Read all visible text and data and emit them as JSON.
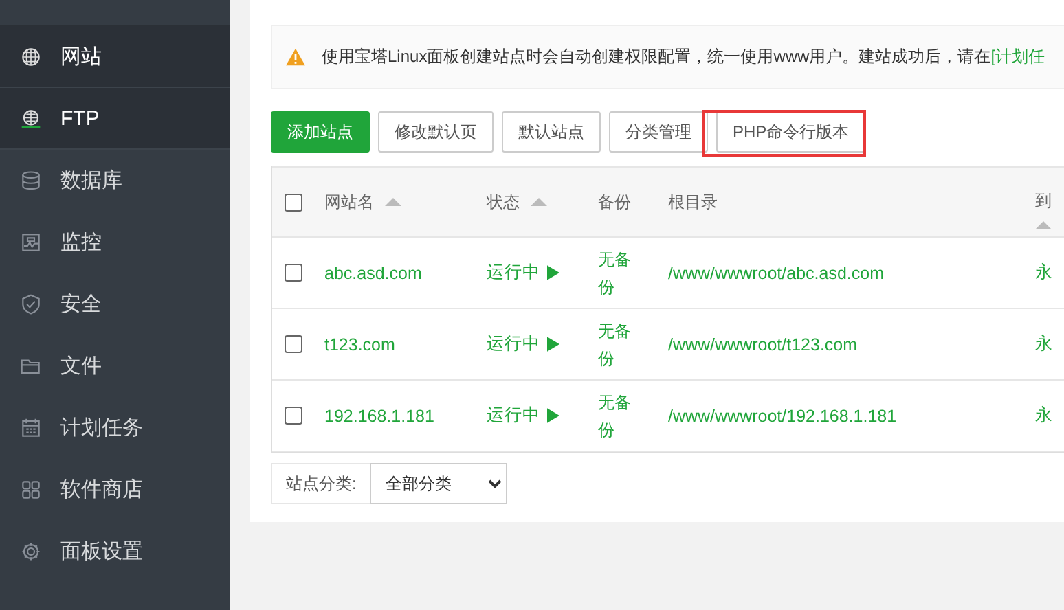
{
  "sidebar": {
    "items": [
      {
        "label": "网站",
        "selected": true
      },
      {
        "label": "FTP",
        "selected": true
      },
      {
        "label": "数据库",
        "selected": false
      },
      {
        "label": "监控",
        "selected": false
      },
      {
        "label": "安全",
        "selected": false
      },
      {
        "label": "文件",
        "selected": false
      },
      {
        "label": "计划任务",
        "selected": false
      },
      {
        "label": "软件商店",
        "selected": false
      },
      {
        "label": "面板设置",
        "selected": false
      }
    ]
  },
  "notice": {
    "text": "使用宝塔Linux面板创建站点时会自动创建权限配置，统一使用www用户。建站成功后，请在",
    "link": "[计划任"
  },
  "toolbar": [
    {
      "label": "添加站点",
      "kind": "primary",
      "highlighted": false
    },
    {
      "label": "修改默认页",
      "kind": "default",
      "highlighted": false
    },
    {
      "label": "默认站点",
      "kind": "default",
      "highlighted": false
    },
    {
      "label": "分类管理",
      "kind": "default",
      "highlighted": false
    },
    {
      "label": "PHP命令行版本",
      "kind": "default",
      "highlighted": true
    }
  ],
  "table": {
    "all_checked": false,
    "columns": [
      {
        "label": "网站名",
        "sortable": true
      },
      {
        "label": "状态",
        "sortable": true
      },
      {
        "label": "备份",
        "sortable": false
      },
      {
        "label": "根目录",
        "sortable": false
      },
      {
        "label": "到",
        "sortable": true
      }
    ],
    "rows": [
      {
        "checked": false,
        "name": "abc.asd.com",
        "status": "运行中",
        "backup": "无备份",
        "root": "/www/wwwroot/abc.asd.com",
        "expiry": "永"
      },
      {
        "checked": false,
        "name": "t123.com",
        "status": "运行中",
        "backup": "无备份",
        "root": "/www/wwwroot/t123.com",
        "expiry": "永"
      },
      {
        "checked": false,
        "name": "192.168.1.181",
        "status": "运行中",
        "backup": "无备份",
        "root": "/www/wwwroot/192.168.1.181",
        "expiry": "永"
      }
    ]
  },
  "filter": {
    "label": "站点分类:",
    "value": "全部分类"
  }
}
